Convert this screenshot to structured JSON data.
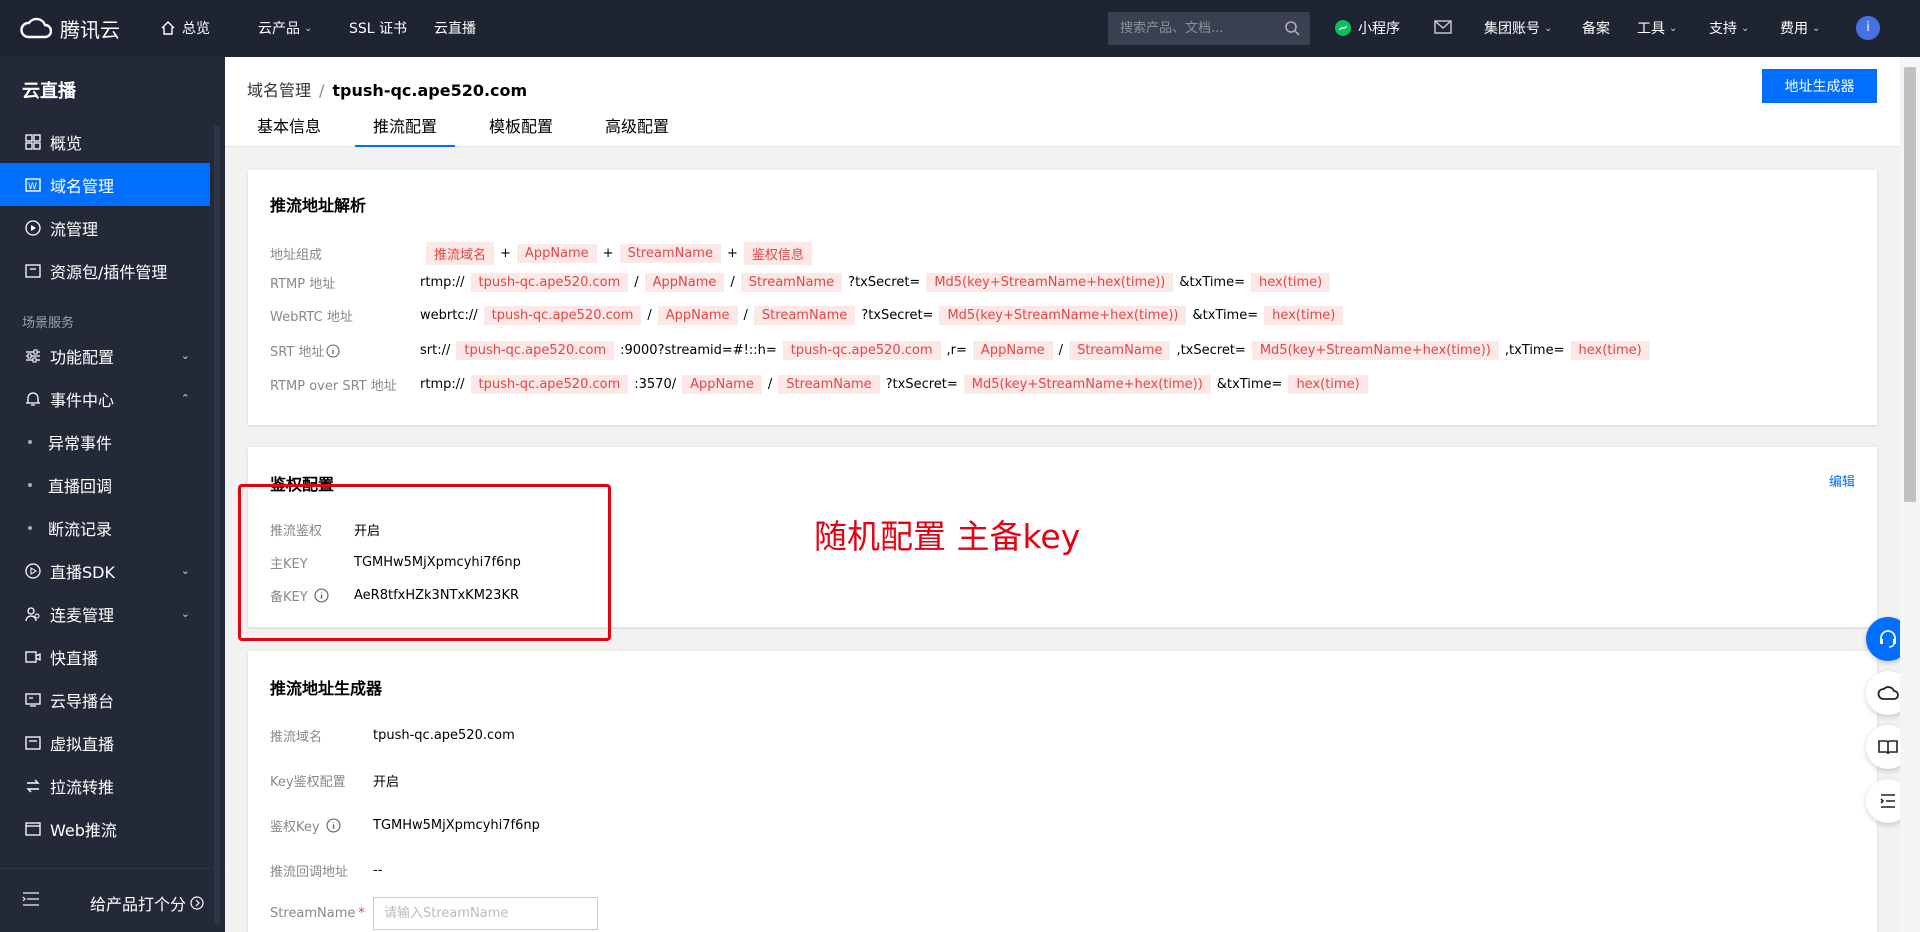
{
  "topnav": {
    "logo": "腾讯云",
    "overview": "总览",
    "products": "云产品",
    "ssl": "SSL 证书",
    "live": "云直播",
    "search_placeholder": "搜索产品、文档...",
    "mini_program": "小程序",
    "group_account": "集团账号",
    "icp": "备案",
    "tools": "工具",
    "support": "支持",
    "billing": "费用",
    "avatar": "i"
  },
  "sidebar": {
    "title": "云直播",
    "overview": "概览",
    "domain": "域名管理",
    "stream": "流管理",
    "resource": "资源包/插件管理",
    "group_label": "场景服务",
    "feature_config": "功能配置",
    "event_center": "事件中心",
    "abnormal": "异常事件",
    "playback": "直播回调",
    "disconnect": "断流记录",
    "sdk": "直播SDK",
    "mic": "连麦管理",
    "fast_live": "快直播",
    "director": "云导播台",
    "virtual": "虚拟直播",
    "pull": "拉流转推",
    "web_push": "Web推流",
    "rate": "给产品打个分"
  },
  "header": {
    "crumb_parent": "域名管理",
    "crumb_sep": "/",
    "crumb_current": "tpush-qc.ape520.com",
    "gen_button": "地址生成器",
    "tabs": [
      "基本信息",
      "推流配置",
      "模板配置",
      "高级配置"
    ]
  },
  "parse_card": {
    "title": "推流地址解析",
    "labels": {
      "compose": "地址组成",
      "rtmp": "RTMP 地址",
      "webrtc": "WebRTC 地址",
      "srt": "SRT 地址",
      "rtmp_srt": "RTMP over SRT 地址"
    },
    "compose": {
      "push_domain": "推流域名",
      "plus": "+",
      "app": "AppName",
      "stream": "StreamName",
      "auth": "鉴权信息"
    },
    "domain": "tpush-qc.ape520.com",
    "rtmp_prefix": "rtmp://",
    "webrtc_prefix": "webrtc://",
    "srt_prefix": "srt://",
    "slash": "/",
    "secret_q": "?txSecret=",
    "md5": "Md5(key+StreamName+hex(time))",
    "txtime": "&txTime=",
    "hex": "hex(time)",
    "srt_port": ":9000?streamid=#!::h=",
    "srt_r": ",r=",
    "srt_secret": ",txSecret=",
    "srt_txtime": ",txTime=",
    "rtmp_srt_port": ":3570/"
  },
  "auth_card": {
    "title": "鉴权配置",
    "edit": "编辑",
    "push_auth_label": "推流鉴权",
    "push_auth_value": "开启",
    "main_key_label": "主KEY",
    "main_key_value": "TGMHw5MjXpmcyhi7f6np",
    "backup_key_label": "备KEY",
    "backup_key_value": "AeR8tfxHZk3NTxKM23KR",
    "annotation": "随机配置 主备key"
  },
  "gen_card": {
    "title": "推流地址生成器",
    "domain_label": "推流域名",
    "domain_value": "tpush-qc.ape520.com",
    "key_auth_label": "Key鉴权配置",
    "key_auth_value": "开启",
    "auth_key_label": "鉴权Key",
    "auth_key_value": "TGMHw5MjXpmcyhi7f6np",
    "callback_label": "推流回调地址",
    "callback_value": "--",
    "stream_label": "StreamName",
    "required": "*",
    "stream_placeholder": "请输入StreamName"
  },
  "colors": {
    "primary": "#006eff",
    "nav_bg": "#1f2432",
    "sidebar_bg": "#242938",
    "pill_bg": "#fde8e8",
    "pill_text": "#e54545",
    "annotation": "#e60012"
  }
}
